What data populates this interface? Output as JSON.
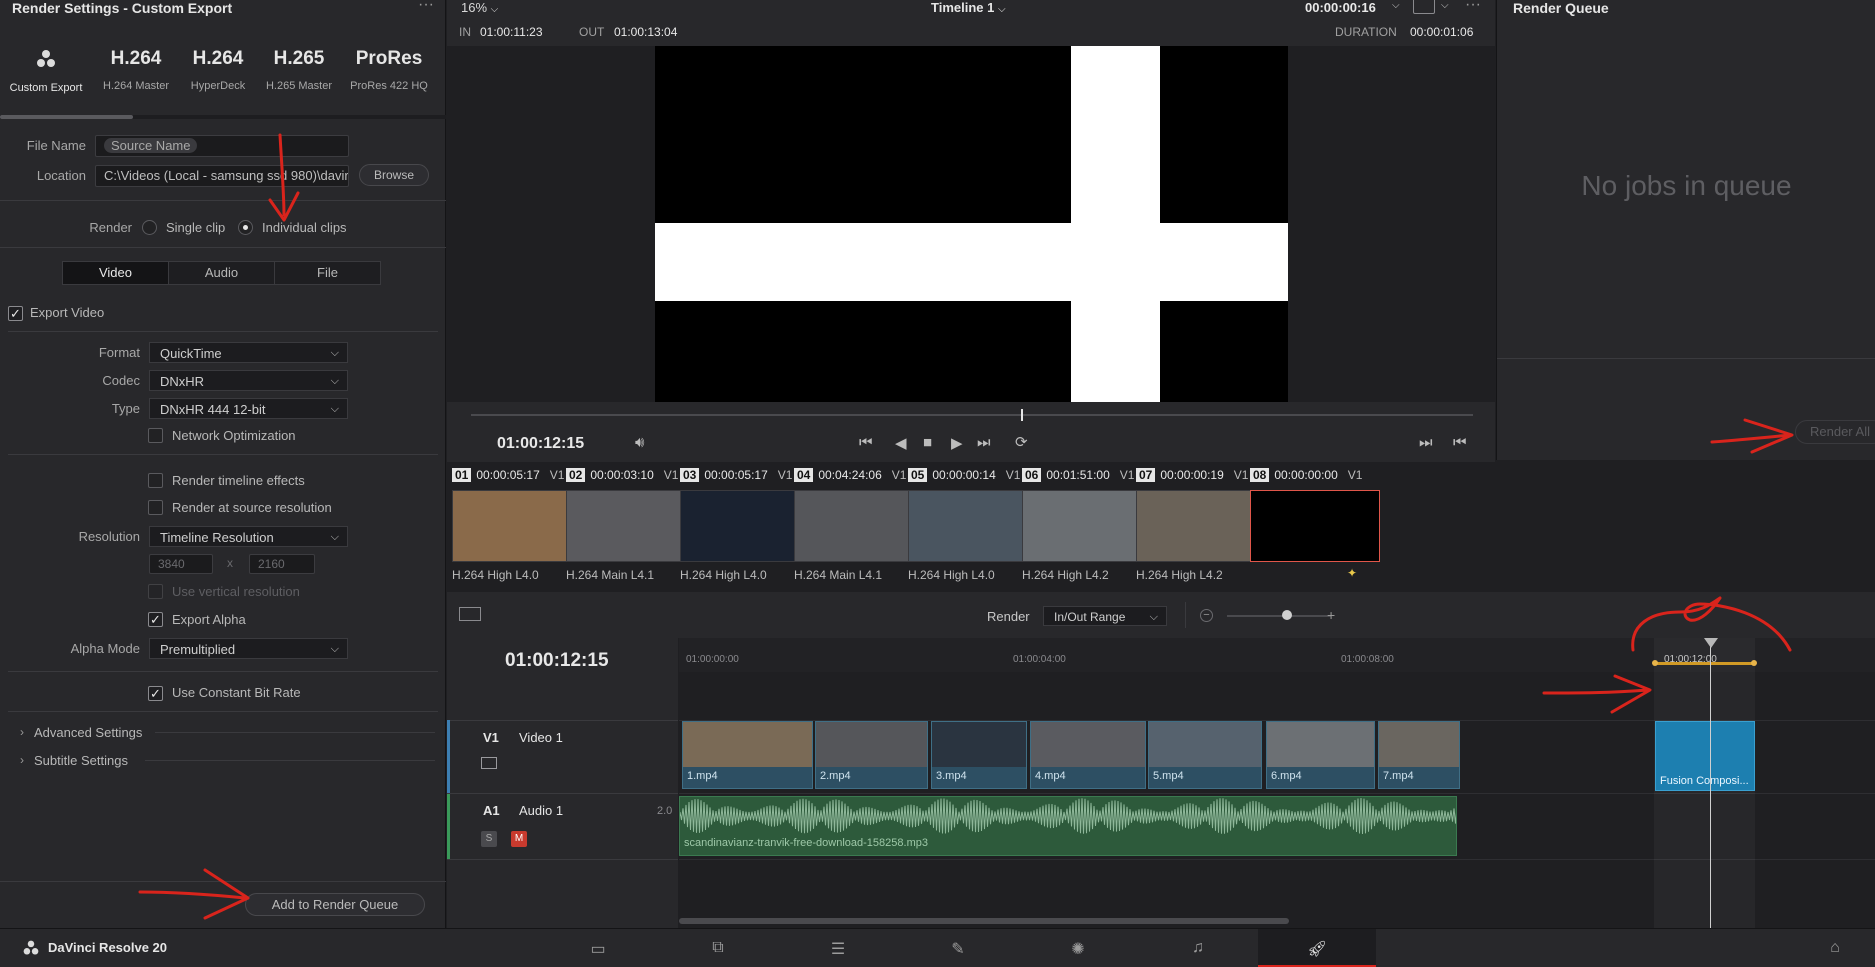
{
  "left_panel": {
    "title": "Render Settings - Custom Export",
    "presets": [
      {
        "big": "",
        "small": "Custom Export",
        "icon": "resolve-logo-icon"
      },
      {
        "big": "H.264",
        "small": "H.264 Master"
      },
      {
        "big": "H.264",
        "small": "HyperDeck"
      },
      {
        "big": "H.265",
        "small": "H.265 Master"
      },
      {
        "big": "ProRes",
        "small": "ProRes 422 HQ"
      }
    ],
    "file_name_label": "File Name",
    "file_name_value": "Source Name",
    "location_label": "Location",
    "location_value": "C:\\Videos (Local - samsung ssd 980)\\davir",
    "browse_label": "Browse",
    "render_label": "Render",
    "render_single": "Single clip",
    "render_individual": "Individual clips",
    "tabs": [
      "Video",
      "Audio",
      "File"
    ],
    "export_video": "Export Video",
    "format_label": "Format",
    "format_value": "QuickTime",
    "codec_label": "Codec",
    "codec_value": "DNxHR",
    "type_label": "Type",
    "type_value": "DNxHR 444 12-bit",
    "network_opt": "Network Optimization",
    "render_timeline_effects": "Render timeline effects",
    "render_source_res": "Render at source resolution",
    "resolution_label": "Resolution",
    "resolution_value": "Timeline Resolution",
    "res_w": "3840",
    "res_x": "x",
    "res_h": "2160",
    "use_vertical": "Use vertical resolution",
    "export_alpha": "Export Alpha",
    "alpha_mode_label": "Alpha Mode",
    "alpha_mode_value": "Premultiplied",
    "constant_bitrate": "Use Constant Bit Rate",
    "advanced": "Advanced Settings",
    "subtitle": "Subtitle Settings",
    "add_queue": "Add to Render Queue"
  },
  "viewer": {
    "zoom": "16%",
    "timeline_name": "Timeline 1",
    "top_tc": "00:00:00:16",
    "in_label": "IN",
    "in_tc": "01:00:11:23",
    "out_label": "OUT",
    "out_tc": "01:00:13:04",
    "duration_label": "DURATION",
    "duration_tc": "00:00:01:06",
    "current_tc": "01:00:12:15"
  },
  "render_queue": {
    "title": "Render Queue",
    "empty": "No jobs in queue",
    "render_all": "Render All"
  },
  "clips": [
    {
      "num": "01",
      "tc": "00:00:05:17",
      "track": "V1",
      "codec": "H.264 High L4.0"
    },
    {
      "num": "02",
      "tc": "00:00:03:10",
      "track": "V1",
      "codec": "H.264 Main L4.1"
    },
    {
      "num": "03",
      "tc": "00:00:05:17",
      "track": "V1",
      "codec": "H.264 High L4.0"
    },
    {
      "num": "04",
      "tc": "00:04:24:06",
      "track": "V1",
      "codec": "H.264 Main L4.1"
    },
    {
      "num": "05",
      "tc": "00:00:00:14",
      "track": "V1",
      "codec": "H.264 High L4.0"
    },
    {
      "num": "06",
      "tc": "00:01:51:00",
      "track": "V1",
      "codec": "H.264 High L4.2"
    },
    {
      "num": "07",
      "tc": "00:00:00:19",
      "track": "V1",
      "codec": "H.264 High L4.2"
    },
    {
      "num": "08",
      "tc": "00:00:00:00",
      "track": "V1",
      "codec": ""
    }
  ],
  "timeline": {
    "render_label": "Render",
    "render_range": "In/Out Range",
    "current_tc": "01:00:12:15",
    "ruler": [
      "01:00:00:00",
      "01:00:04:00",
      "01:00:08:00",
      "01:00:12:00"
    ],
    "v1_label": "V1",
    "v1_name": "Video 1",
    "a1_label": "A1",
    "a1_name": "Audio 1",
    "a1_channels": "2.0",
    "solo": "S",
    "mute": "M",
    "video_clips": [
      "1.mp4",
      "2.mp4",
      "3.mp4",
      "4.mp4",
      "5.mp4",
      "6.mp4",
      "7.mp4"
    ],
    "fusion_clip": "Fusion Composi...",
    "audio_clip": "scandinavianz-tranvik-free-download-158258.mp3"
  },
  "bottom": {
    "app_name": "DaVinci Resolve 20"
  },
  "colors": {
    "accent_red": "#d9241c",
    "clip_blue": "#2d4f63",
    "audio_green": "#2d5a3b",
    "fusion_blue": "#1d7fb0"
  }
}
